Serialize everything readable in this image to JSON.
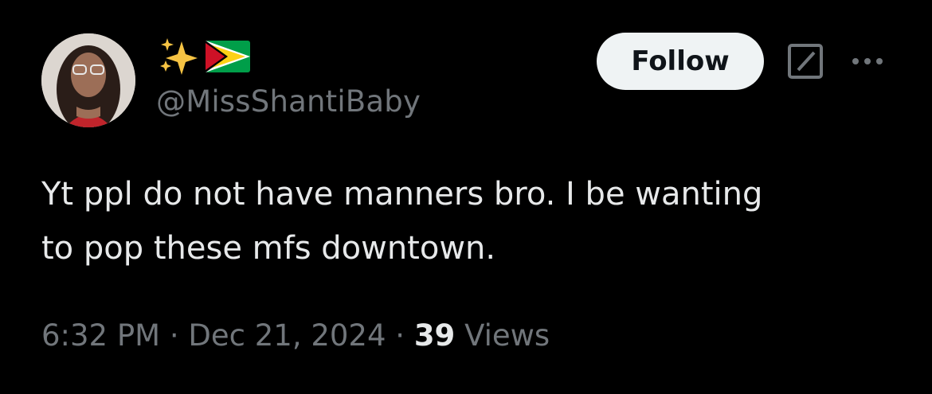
{
  "author": {
    "display_name_emoji": [
      "sparkles",
      "guyana-flag"
    ],
    "handle": "@MissShantiBaby"
  },
  "actions": {
    "follow_label": "Follow",
    "grok_icon": "grok-icon",
    "more_icon": "more-icon"
  },
  "tweet": {
    "text": "Yt ppl do not have manners bro. I be wanting\nto pop these mfs downtown."
  },
  "meta": {
    "time": "6:32 PM",
    "separator": " · ",
    "date": "Dec 21, 2024",
    "views_count": "39",
    "views_label": " Views"
  },
  "colors": {
    "background": "#000000",
    "primary_text": "#e7e9ea",
    "secondary_text": "#71767b",
    "follow_bg": "#eff3f4",
    "follow_text": "#0f1419"
  }
}
